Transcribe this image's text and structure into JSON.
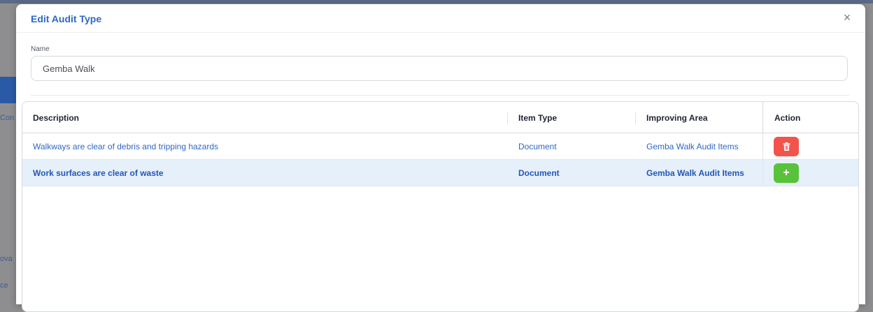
{
  "background": {
    "sidebar_texts": [
      "Con",
      "ova",
      "ce"
    ]
  },
  "modal": {
    "title": "Edit Audit Type",
    "close_glyph": "×",
    "name_field": {
      "label": "Name",
      "value": "Gemba Walk"
    }
  },
  "table": {
    "headers": {
      "description": "Description",
      "item_type": "Item Type",
      "improving_area": "Improving Area",
      "action": "Action"
    },
    "rows": [
      {
        "description": "Walkways are clear of debris and tripping hazards",
        "item_type": "Document",
        "improving_area": "Gemba Walk Audit Items",
        "action_icon": "trash-icon"
      },
      {
        "description": "Work surfaces are clear of waste",
        "item_type": "Document",
        "improving_area": "Gemba Walk Audit Items",
        "action_icon": "plus-icon",
        "action_glyph": "+"
      }
    ]
  },
  "colors": {
    "accent": "#2f67c4",
    "delete": "#f2544c",
    "add": "#59c23b",
    "selected_row": "#e6f0fb"
  }
}
